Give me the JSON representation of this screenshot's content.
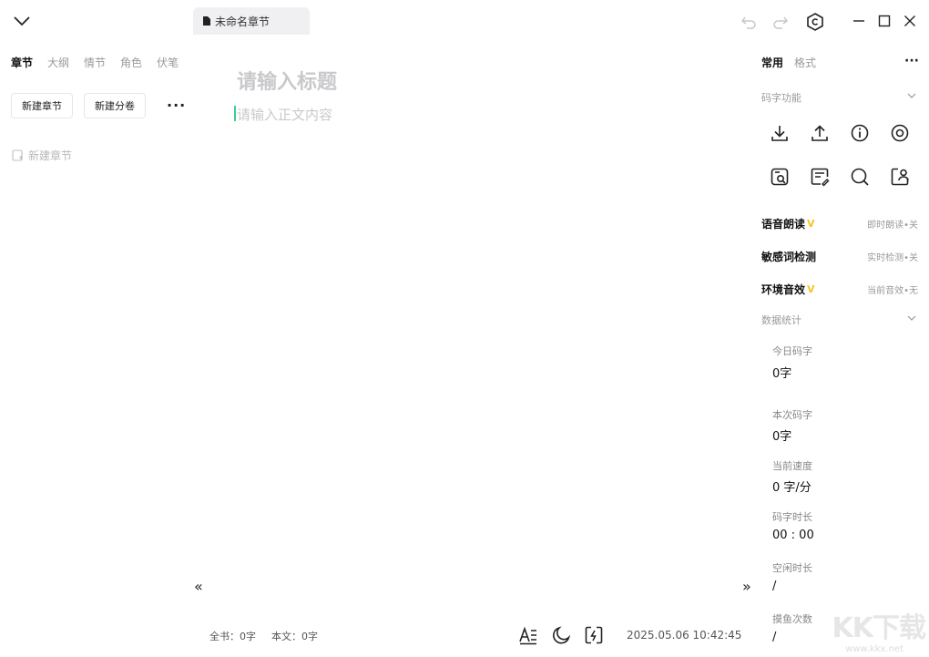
{
  "header": {
    "doc_tab_label": "未命名章节"
  },
  "left_panel": {
    "tabs": [
      "章节",
      "大纲",
      "情节",
      "角色",
      "伏笔"
    ],
    "new_chapter_button": "新建章节",
    "new_volume_button": "新建分卷",
    "more_label": "···",
    "chapter_placeholder_item": "新建章节"
  },
  "editor": {
    "title_placeholder": "请输入标题",
    "body_placeholder": "请输入正文内容",
    "collapse_left": "«",
    "expand_right": "»"
  },
  "right_panel": {
    "tabs": [
      "常用",
      "格式"
    ],
    "more_label": "···",
    "typing_section_title": "码字功能",
    "tool_icons": [
      "download-icon",
      "upload-icon",
      "info-icon",
      "eye-icon",
      "image-search-icon",
      "card-edit-icon",
      "search-icon",
      "user-share-icon"
    ],
    "features": [
      {
        "label": "语音朗读",
        "vip": "V",
        "status": "即时朗读•关"
      },
      {
        "label": "敏感词检测",
        "vip": "",
        "status": "实时检测•关"
      },
      {
        "label": "环境音效",
        "vip": "V",
        "status": "当前音效•无"
      }
    ],
    "stats_section_title": "数据统计",
    "stats": [
      {
        "label": "今日码字",
        "value": "0字"
      },
      {
        "label": "本次码字",
        "value": "0字"
      },
      {
        "label": "当前速度",
        "value": "0 字/分"
      },
      {
        "label": "码字时长",
        "value": "00 : 00"
      },
      {
        "label": "空闲时长",
        "value": "/"
      },
      {
        "label": "摸鱼次数",
        "value": "/"
      }
    ]
  },
  "footer": {
    "total_book": "全书：0字",
    "body_count": "本文：0字",
    "datetime": "2025.05.06 10:42:45"
  },
  "watermark": {
    "text": "KK下载",
    "url": "www.kkx.net"
  },
  "colors": {
    "accent_caret": "#3ccf8e",
    "vip_badge": "#f3c623"
  }
}
